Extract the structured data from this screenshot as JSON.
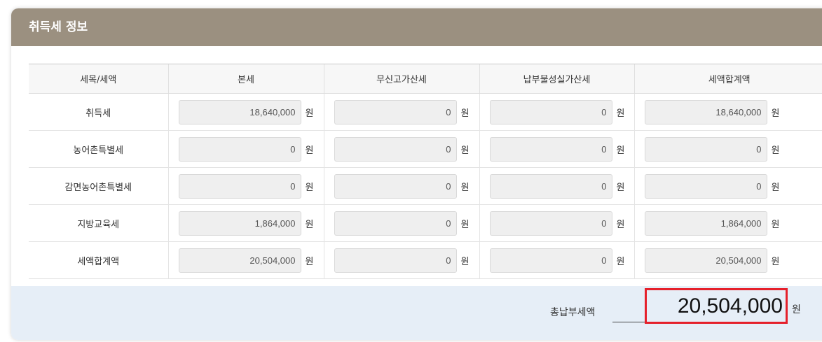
{
  "panel": {
    "title": "취득세 정보"
  },
  "table": {
    "headers": [
      "세목/세액",
      "본세",
      "무신고가산세",
      "납부불성실가산세",
      "세액합계액"
    ],
    "unit": "원",
    "rows": [
      {
        "label": "취득세",
        "values": [
          "18,640,000",
          "0",
          "0",
          "18,640,000"
        ]
      },
      {
        "label": "농어촌특별세",
        "values": [
          "0",
          "0",
          "0",
          "0"
        ]
      },
      {
        "label": "감면농어촌특별세",
        "values": [
          "0",
          "0",
          "0",
          "0"
        ]
      },
      {
        "label": "지방교육세",
        "values": [
          "1,864,000",
          "0",
          "0",
          "1,864,000"
        ]
      },
      {
        "label": "세액합계액",
        "values": [
          "20,504,000",
          "0",
          "0",
          "20,504,000"
        ]
      }
    ]
  },
  "total": {
    "label": "총납부세액",
    "value": "20,504,000",
    "unit": "원"
  },
  "colors": {
    "header_bg": "#9b9080",
    "total_bg": "#e6eef7",
    "highlight_border": "#e5202b"
  }
}
